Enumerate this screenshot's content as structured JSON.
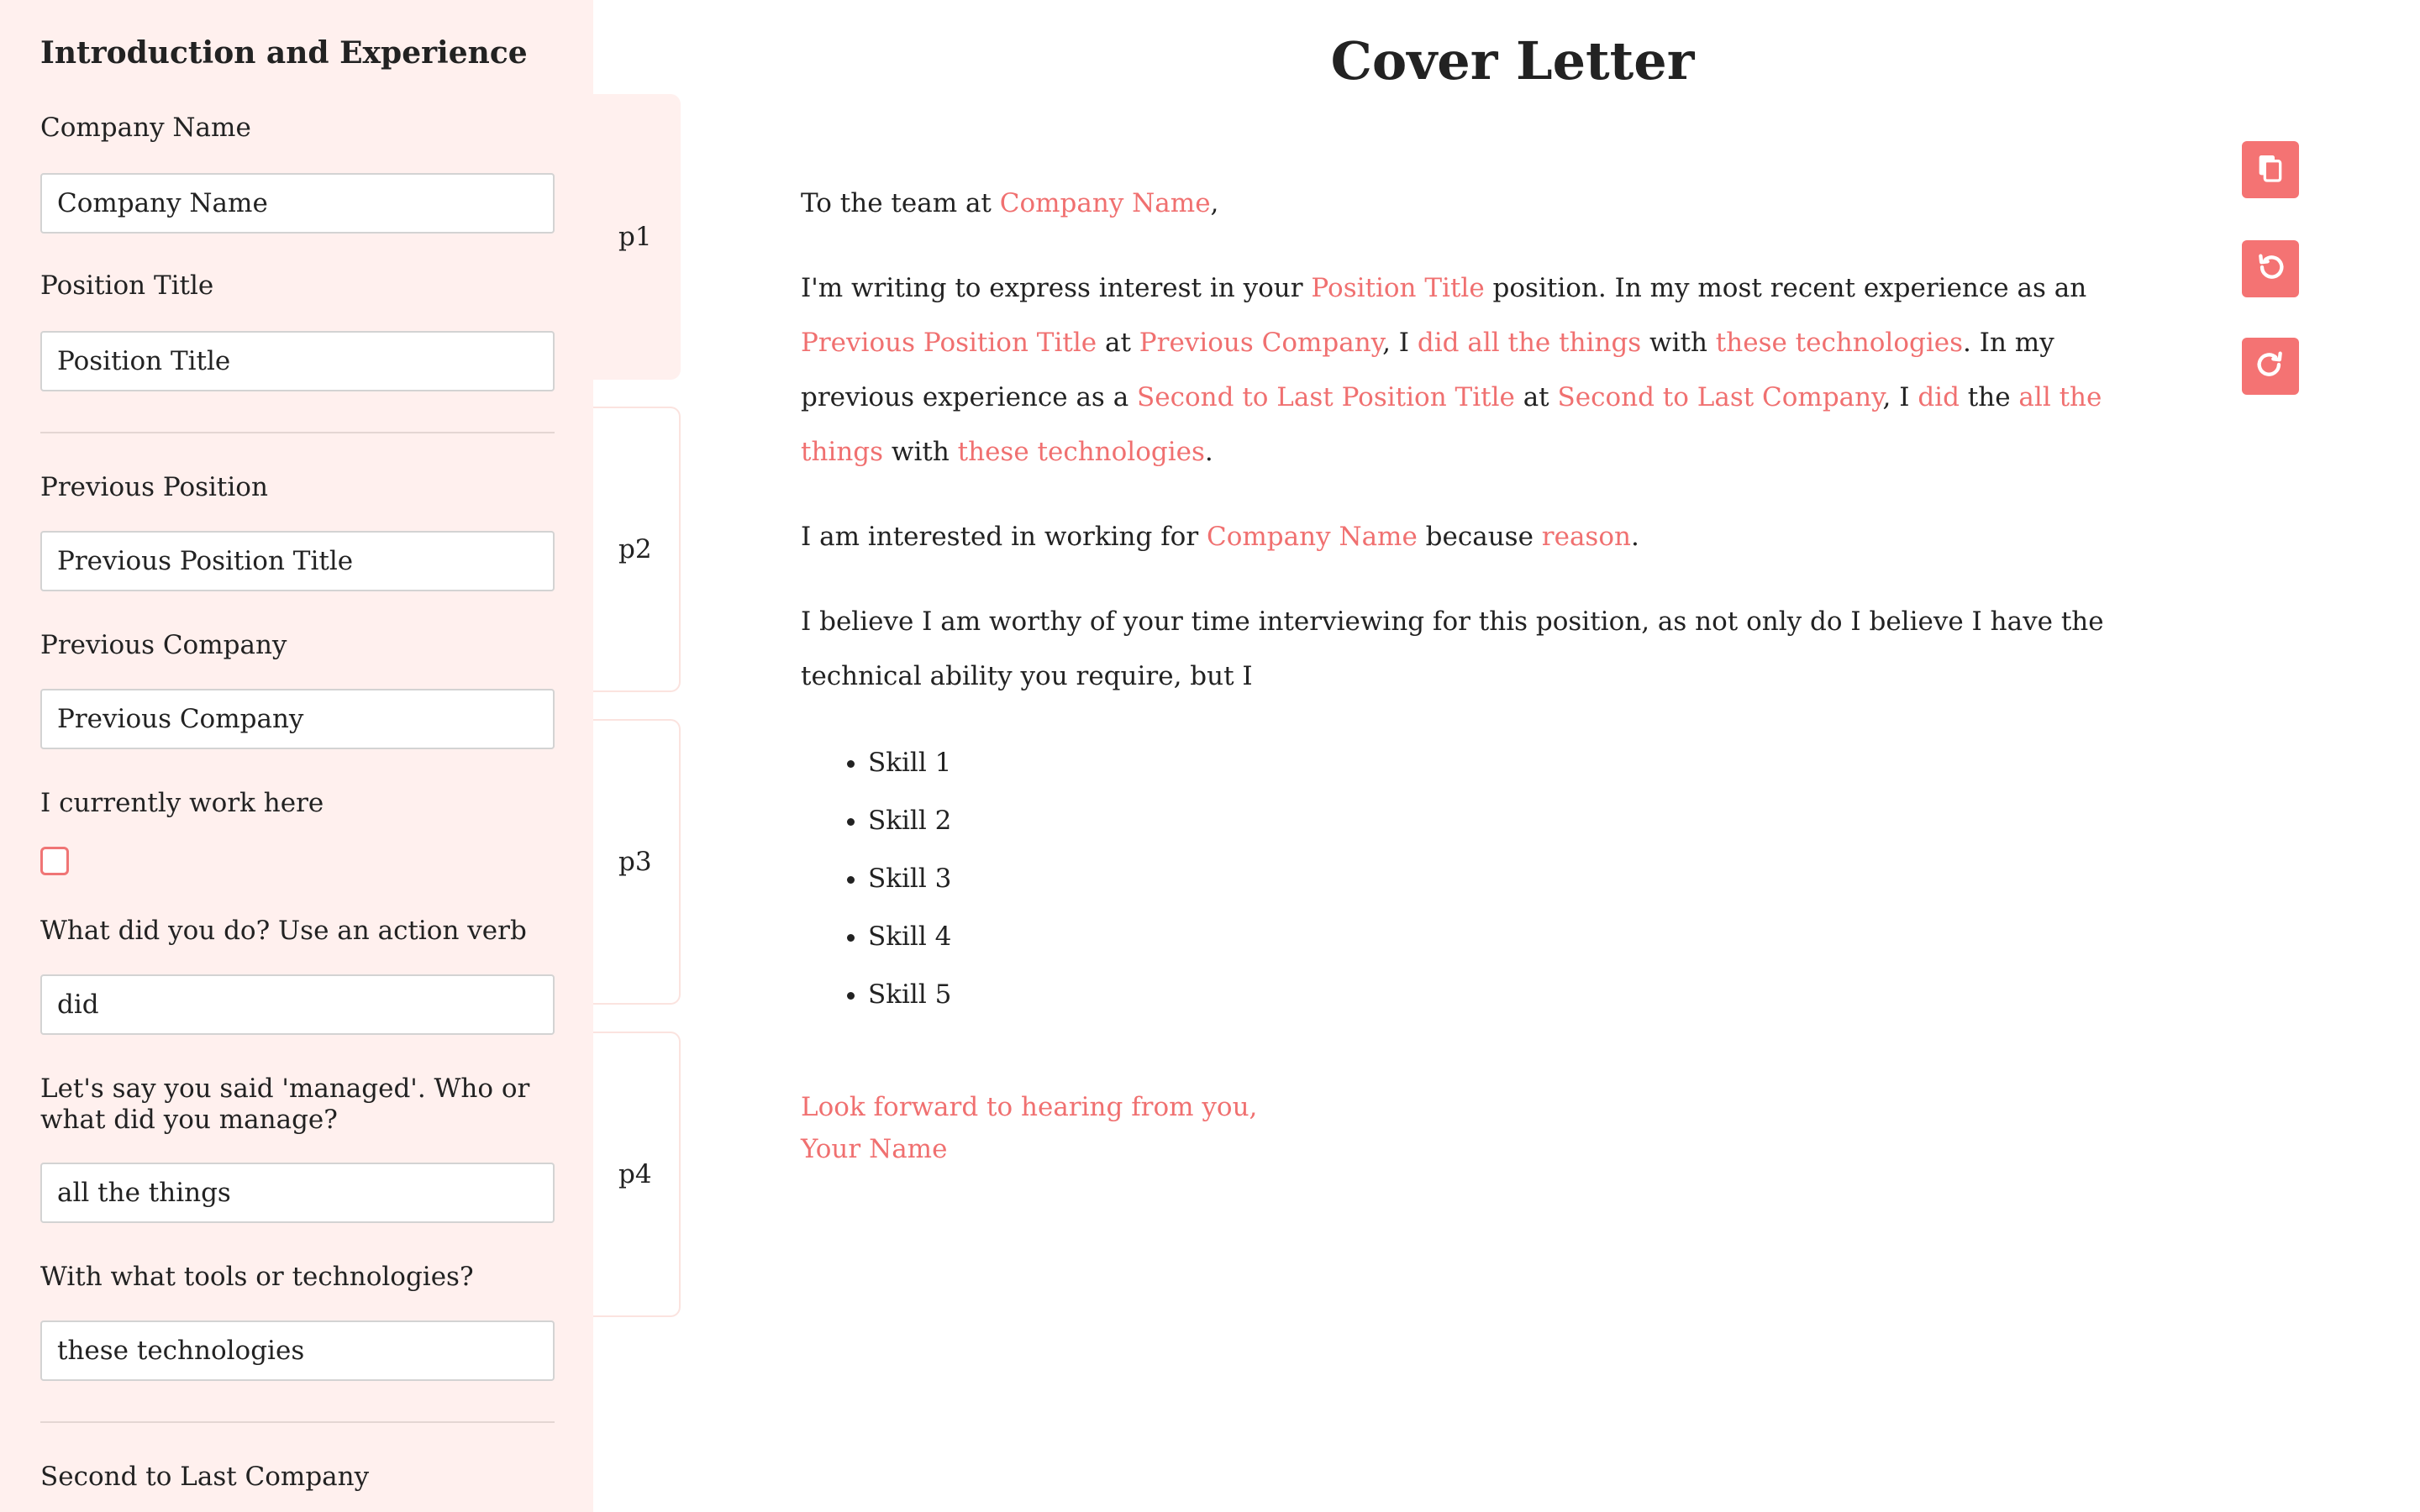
{
  "sidebar": {
    "heading": "Introduction and Experience",
    "fields": {
      "company_name": {
        "label": "Company Name",
        "value": "Company Name"
      },
      "position_title": {
        "label": "Position Title",
        "value": "Position Title"
      },
      "previous_position": {
        "label": "Previous Position",
        "value": "Previous Position Title"
      },
      "previous_company": {
        "label": "Previous Company",
        "value": "Previous Company"
      },
      "currently_work_here": {
        "label": "I currently work here",
        "checked": false
      },
      "action_verb": {
        "label": "What did you do? Use an action verb",
        "value": "did"
      },
      "managed_what": {
        "label": "Let's say you said 'managed'. Who or what did you manage?",
        "value": "all the things"
      },
      "tools": {
        "label": "With what tools or technologies?",
        "value": "these technologies"
      },
      "second_to_last_company": {
        "label": "Second to Last Company"
      }
    }
  },
  "pages": [
    {
      "label": "p1",
      "active": true
    },
    {
      "label": "p2",
      "active": false
    },
    {
      "label": "p3",
      "active": false
    },
    {
      "label": "p4",
      "active": false
    }
  ],
  "letter": {
    "title": "Cover Letter",
    "greeting": {
      "prefix": "To the team at ",
      "company": "Company Name",
      "suffix": ","
    },
    "para1": {
      "t1": "I'm writing to express interest in your ",
      "position": "Position Title",
      "t2": " position. In my most recent experience as an ",
      "prev_position": "Previous Position Title",
      "t3": " at ",
      "prev_company": "Previous Company",
      "t4": ", I ",
      "did_all": "did all the things",
      "t5": " with ",
      "tech1": "these technologies",
      "t6": ". In my previous experience as a ",
      "second_position": "Second to Last Position Title",
      "t7": " at ",
      "second_company": "Second to Last Company",
      "t8": ", I ",
      "did": "did",
      "t9": " the ",
      "all_things": "all the things",
      "t10": " with ",
      "tech2": "these technologies",
      "t11": "."
    },
    "para2": {
      "t1": "I am interested in working for ",
      "company": "Company Name",
      "t2": " because ",
      "reason": "reason",
      "t3": "."
    },
    "para3": "I believe I am worthy of your time interviewing for this position, as not only do I believe I have the technical ability you require, but I",
    "skills": [
      "Skill 1",
      "Skill 2",
      "Skill 3",
      "Skill 4",
      "Skill 5"
    ],
    "closing": "Look forward to hearing from you,",
    "signature": "Your Name"
  },
  "actions": {
    "copy_icon": "copy-icon",
    "undo_icon": "undo-icon",
    "redo_icon": "redo-icon"
  },
  "colors": {
    "accent": "#f07070",
    "sidebar_bg": "#fff0ee",
    "button_bg": "#f47373"
  }
}
